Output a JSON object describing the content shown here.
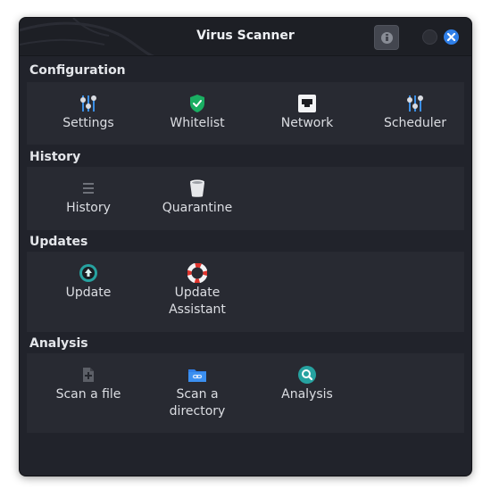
{
  "window": {
    "title": "Virus Scanner"
  },
  "sections": {
    "configuration": {
      "title": "Configuration",
      "items": [
        {
          "label": "Settings",
          "icon": "sliders-icon"
        },
        {
          "label": "Whitelist",
          "icon": "shield-check-icon"
        },
        {
          "label": "Network",
          "icon": "network-icon"
        },
        {
          "label": "Scheduler",
          "icon": "sliders-icon"
        }
      ]
    },
    "history": {
      "title": "History",
      "items": [
        {
          "label": "History",
          "icon": "list-icon"
        },
        {
          "label": "Quarantine",
          "icon": "trash-icon"
        }
      ]
    },
    "updates": {
      "title": "Updates",
      "items": [
        {
          "label": "Update",
          "icon": "update-arrow-icon"
        },
        {
          "label": "Update\nAssistant",
          "icon": "lifebuoy-icon"
        }
      ]
    },
    "analysis": {
      "title": "Analysis",
      "items": [
        {
          "label": "Scan a file",
          "icon": "file-add-icon"
        },
        {
          "label": "Scan a\ndirectory",
          "icon": "folder-link-icon"
        },
        {
          "label": "Analysis",
          "icon": "magnifier-icon"
        }
      ]
    }
  },
  "colors": {
    "background": "#21232b",
    "panel": "#282a32",
    "accent_blue": "#2f7fe8",
    "teal": "#26a2a0",
    "shield_green": "#1aae62"
  }
}
